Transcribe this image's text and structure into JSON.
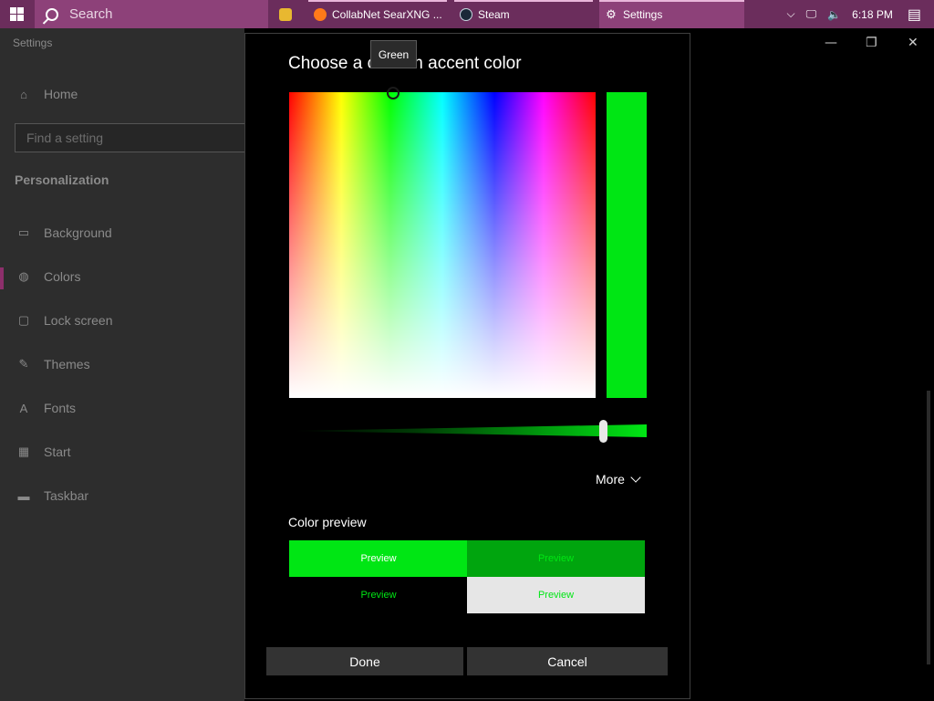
{
  "taskbar": {
    "search_label": "Search",
    "apps": [
      {
        "label": "",
        "icon": "file-explorer-icon"
      },
      {
        "label": "CollabNet SearXNG ...",
        "icon": "firefox-icon"
      },
      {
        "label": "Steam",
        "icon": "steam-icon"
      },
      {
        "label": "Settings",
        "icon": "gear-icon"
      }
    ],
    "clock": "6:18 PM",
    "accent": "#6b2d5c"
  },
  "settings": {
    "window_title": "Settings",
    "home": "Home",
    "search_placeholder": "Find a setting",
    "section": "Personalization",
    "nav": [
      "Background",
      "Colors",
      "Lock screen",
      "Themes",
      "Fonts",
      "Start",
      "Taskbar"
    ],
    "selected": "Colors"
  },
  "dialog": {
    "title": "Choose a custom accent color",
    "tooltip": "Green",
    "selected_color": "#00e614",
    "more_label": "More",
    "preview_label": "Color preview",
    "previews": [
      "Preview",
      "Preview",
      "Preview",
      "Preview"
    ],
    "done_label": "Done",
    "cancel_label": "Cancel"
  }
}
